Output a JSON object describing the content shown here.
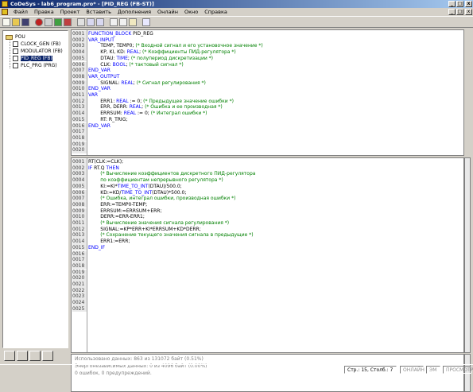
{
  "window": {
    "title": "CoDeSys - lab6_program.pro* - [PID_REG (FB-ST)]",
    "controls": [
      "_",
      "□",
      "x"
    ]
  },
  "menu": {
    "items": [
      "Файл",
      "Правка",
      "Проект",
      "Вставить",
      "Дополнения",
      "Онлайн",
      "Окно",
      "Справка"
    ],
    "controls": [
      "_",
      "□",
      "x"
    ]
  },
  "tree": {
    "root": "POU",
    "items": [
      {
        "label": "CLOCK_GEN (FB)"
      },
      {
        "label": "MODULATOR (FB)"
      },
      {
        "label": "PID_REG (FB)",
        "selected": true
      },
      {
        "label": "PLC_PRG (PRG)"
      }
    ]
  },
  "declaration": {
    "lines": [
      {
        "n": "0001",
        "segs": [
          {
            "t": "FUNCTION_BLOCK ",
            "k": "kw"
          },
          {
            "t": "PID_REG",
            "k": "pl"
          }
        ]
      },
      {
        "n": "0002",
        "segs": [
          {
            "t": "VAR_INPUT",
            "k": "kw"
          }
        ]
      },
      {
        "n": "0003",
        "segs": [
          {
            "t": "        TEMP, TEMP0; ",
            "k": "pl"
          },
          {
            "t": "(* Входной сигнал и его установочное значение *)",
            "k": "cm"
          }
        ]
      },
      {
        "n": "0004",
        "segs": [
          {
            "t": "        KP, KI, KD: ",
            "k": "pl"
          },
          {
            "t": "REAL",
            "k": "kw"
          },
          {
            "t": "; ",
            "k": "pl"
          },
          {
            "t": "(* Коэффициенты ПИД-регулятора *)",
            "k": "cm"
          }
        ]
      },
      {
        "n": "0005",
        "segs": [
          {
            "t": "        DTAU: ",
            "k": "pl"
          },
          {
            "t": "TIME",
            "k": "kw"
          },
          {
            "t": "; ",
            "k": "pl"
          },
          {
            "t": "(* полупериод дискретизации *)",
            "k": "cm"
          }
        ]
      },
      {
        "n": "0006",
        "segs": [
          {
            "t": "        CLK: ",
            "k": "pl"
          },
          {
            "t": "BOOL",
            "k": "kw"
          },
          {
            "t": "; ",
            "k": "pl"
          },
          {
            "t": "(* тактовый сигнал *)",
            "k": "cm"
          }
        ]
      },
      {
        "n": "0007",
        "segs": [
          {
            "t": "END_VAR",
            "k": "kw"
          }
        ]
      },
      {
        "n": "0008",
        "segs": [
          {
            "t": "VAR_OUTPUT",
            "k": "kw"
          }
        ]
      },
      {
        "n": "0009",
        "segs": [
          {
            "t": "        SIGNAL: ",
            "k": "pl"
          },
          {
            "t": "REAL",
            "k": "kw"
          },
          {
            "t": "; ",
            "k": "pl"
          },
          {
            "t": "(* Сигнал регулирования *)",
            "k": "cm"
          }
        ]
      },
      {
        "n": "0010",
        "segs": [
          {
            "t": "END_VAR",
            "k": "kw"
          }
        ]
      },
      {
        "n": "0011",
        "segs": [
          {
            "t": "VAR",
            "k": "kw"
          }
        ]
      },
      {
        "n": "0012",
        "segs": [
          {
            "t": "        ERR1: ",
            "k": "pl"
          },
          {
            "t": "REAL",
            "k": "kw"
          },
          {
            "t": " := 0; ",
            "k": "pl"
          },
          {
            "t": "(* Предыдущее значение ошибки *)",
            "k": "cm"
          }
        ]
      },
      {
        "n": "0013",
        "segs": [
          {
            "t": "        ERR, DERR: ",
            "k": "pl"
          },
          {
            "t": "REAL",
            "k": "kw"
          },
          {
            "t": "; ",
            "k": "pl"
          },
          {
            "t": "(* Ошибка и ее производная *)",
            "k": "cm"
          }
        ]
      },
      {
        "n": "0014",
        "segs": [
          {
            "t": "        ERRSUM: ",
            "k": "pl"
          },
          {
            "t": "REAL",
            "k": "kw"
          },
          {
            "t": " := 0; ",
            "k": "pl"
          },
          {
            "t": "(* Интеграл ошибки *)",
            "k": "cm"
          }
        ]
      },
      {
        "n": "0015",
        "segs": [
          {
            "t": "        RT: R_TRIG;",
            "k": "pl"
          }
        ]
      },
      {
        "n": "0016",
        "segs": [
          {
            "t": "END_VAR",
            "k": "kw"
          }
        ]
      },
      {
        "n": "0017",
        "segs": []
      },
      {
        "n": "0018",
        "segs": []
      },
      {
        "n": "0019",
        "segs": []
      },
      {
        "n": "0020",
        "segs": []
      }
    ]
  },
  "implementation": {
    "lines": [
      {
        "n": "0001",
        "segs": [
          {
            "t": "RT(CLK:=CLK);",
            "k": "pl"
          }
        ]
      },
      {
        "n": "0002",
        "segs": [
          {
            "t": "IF ",
            "k": "kw"
          },
          {
            "t": "RT.Q ",
            "k": "pl"
          },
          {
            "t": "THEN",
            "k": "kw"
          }
        ]
      },
      {
        "n": "0003",
        "segs": [
          {
            "t": "        (* Вычисление коэффициентов дискретного ПИД-регулятора",
            "k": "cm"
          }
        ]
      },
      {
        "n": "0004",
        "segs": [
          {
            "t": "        по коэффициентам непрерывного регулятора *)",
            "k": "cm"
          }
        ]
      },
      {
        "n": "0005",
        "segs": [
          {
            "t": "        KI:=KI*",
            "k": "pl"
          },
          {
            "t": "TIME_TO_INT",
            "k": "kw"
          },
          {
            "t": "(DTAU)/500.0;",
            "k": "pl"
          }
        ]
      },
      {
        "n": "0006",
        "segs": [
          {
            "t": "        KD:=KD/",
            "k": "pl"
          },
          {
            "t": "TIME_TO_INT",
            "k": "kw"
          },
          {
            "t": "(DTAU)*500.0;",
            "k": "pl"
          }
        ]
      },
      {
        "n": "0007",
        "segs": [
          {
            "t": "        (* Ошибка, интеграл ошибки, производная ошибки *)",
            "k": "cm"
          }
        ]
      },
      {
        "n": "0008",
        "segs": [
          {
            "t": "        ERR:=TEMP0-TEMP;",
            "k": "pl"
          }
        ]
      },
      {
        "n": "0009",
        "segs": [
          {
            "t": "        ERRSUM:=ERRSUM+ERR;",
            "k": "pl"
          }
        ]
      },
      {
        "n": "0010",
        "segs": [
          {
            "t": "        DERR:=ERR-ERR1;",
            "k": "pl"
          }
        ]
      },
      {
        "n": "0011",
        "segs": [
          {
            "t": "        (* Вычисление значения сигнала регулирования *)",
            "k": "cm"
          }
        ]
      },
      {
        "n": "0012",
        "segs": [
          {
            "t": "        SIGNAL:=KP*ERR+KI*ERRSUM+KD*DERR;",
            "k": "pl"
          }
        ]
      },
      {
        "n": "0013",
        "segs": [
          {
            "t": "        (* Сохранение текущего значения сигнала в предыдущие *)",
            "k": "cm"
          }
        ]
      },
      {
        "n": "0014",
        "segs": [
          {
            "t": "        ERR1:=ERR;",
            "k": "pl"
          }
        ]
      },
      {
        "n": "0015",
        "segs": [
          {
            "t": "END_IF",
            "k": "kw"
          }
        ]
      },
      {
        "n": "0016",
        "segs": []
      },
      {
        "n": "0017",
        "segs": []
      },
      {
        "n": "0018",
        "segs": []
      },
      {
        "n": "0019",
        "segs": []
      },
      {
        "n": "0020",
        "segs": []
      },
      {
        "n": "0021",
        "segs": []
      },
      {
        "n": "0022",
        "segs": []
      },
      {
        "n": "0023",
        "segs": []
      },
      {
        "n": "0024",
        "segs": []
      },
      {
        "n": "0025",
        "segs": []
      }
    ]
  },
  "messages": [
    "Использовано данных: 863 из 131072 байт (0.51%)",
    "Энергонезависимых данных: 0 из 4096 байт (0.00%)",
    "0 ошибок, 0 предупреждений."
  ],
  "status": {
    "position": "Стр.: 15, Столб.: 7",
    "online": "ОНЛАЙН",
    "sim": "ЭМ",
    "overwrite": "ПРОСМОТР"
  }
}
